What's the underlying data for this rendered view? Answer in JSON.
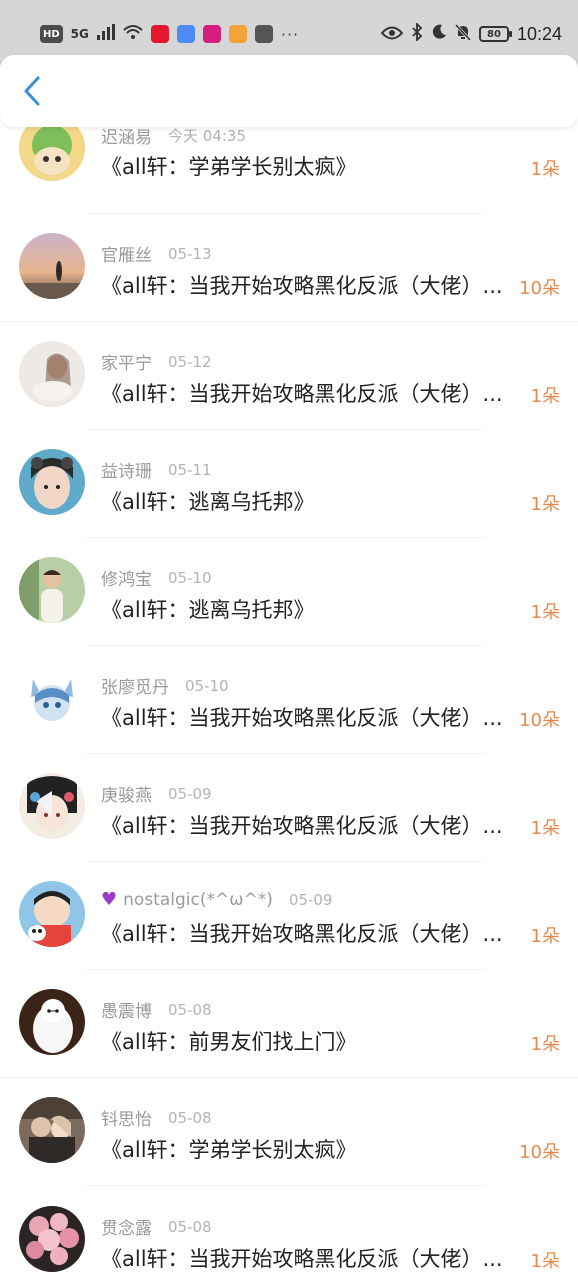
{
  "status_bar": {
    "hd": "HD",
    "network": "5G",
    "dots": "···",
    "battery": "80",
    "time": "10:24"
  },
  "header": {
    "back_icon": "chevron-left-icon"
  },
  "colors": {
    "accent": "#3a8fd9",
    "count": "#e8884a"
  },
  "items": [
    {
      "name": "迟涵易",
      "date": "今天 04:35",
      "title": "《all轩：学弟学长别太疯》",
      "count": "1朵"
    },
    {
      "name": "官雁丝",
      "date": "05-13",
      "title": "《all轩：当我开始攻略黑化反派（大佬）...",
      "count": "10朵"
    },
    {
      "name": "家平宁",
      "date": "05-12",
      "title": "《all轩：当我开始攻略黑化反派（大佬）...",
      "count": "1朵"
    },
    {
      "name": "益诗珊",
      "date": "05-11",
      "title": "《all轩：逃离乌托邦》",
      "count": "1朵"
    },
    {
      "name": "修鸿宝",
      "date": "05-10",
      "title": "《all轩：逃离乌托邦》",
      "count": "1朵"
    },
    {
      "name": "张廖觅丹",
      "date": "05-10",
      "title": "《all轩：当我开始攻略黑化反派（大佬）...",
      "count": "10朵"
    },
    {
      "name": "庚骏燕",
      "date": "05-09",
      "title": "《all轩：当我开始攻略黑化反派（大佬）...",
      "count": "1朵"
    },
    {
      "name": "nostalgic(*^ω^*)",
      "date": "05-09",
      "title": "《all轩：当我开始攻略黑化反派（大佬）...",
      "count": "1朵"
    },
    {
      "name": "愚震博",
      "date": "05-08",
      "title": "《all轩：前男友们找上门》",
      "count": "1朵"
    },
    {
      "name": "钭思怡",
      "date": "05-08",
      "title": "《all轩：学弟学长别太疯》",
      "count": "10朵"
    },
    {
      "name": "贯念露",
      "date": "05-08",
      "title": "《all轩：当我开始攻略黑化反派（大佬）...",
      "count": "1朵"
    }
  ]
}
